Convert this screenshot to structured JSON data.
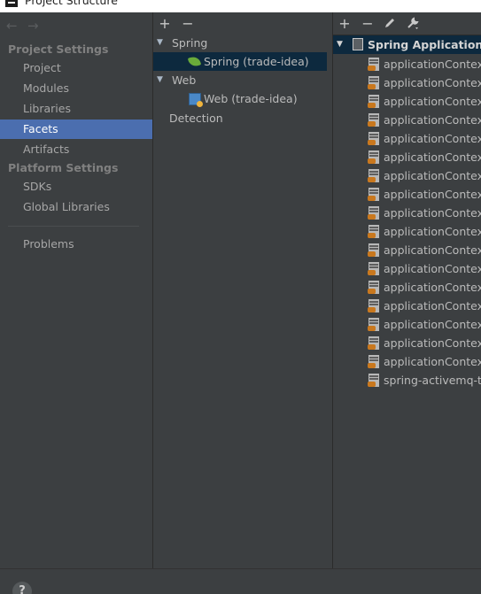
{
  "window": {
    "title": "Project Structure"
  },
  "nav": {
    "back_icon": "←",
    "forward_icon": "→",
    "project_settings_heading": "Project Settings",
    "project_settings_items": [
      "Project",
      "Modules",
      "Libraries",
      "Facets",
      "Artifacts"
    ],
    "platform_settings_heading": "Platform Settings",
    "platform_settings_items": [
      "SDKs",
      "Global Libraries"
    ],
    "problems_label": "Problems",
    "selected_item": "Facets"
  },
  "facets_tree": {
    "add_label": "+",
    "remove_label": "−",
    "groups": [
      {
        "label": "Spring",
        "children": [
          "Spring (trade-idea)"
        ]
      },
      {
        "label": "Web",
        "children": [
          "Web (trade-idea)"
        ]
      }
    ],
    "detection_label": "Detection",
    "selected_item": "Spring (trade-idea)"
  },
  "context_panel": {
    "add_label": "+",
    "remove_label": "−",
    "group_label": "Spring Application Context",
    "files": [
      "applicationContext_",
      "applicationContext_",
      "applicationContext_",
      "applicationContext_",
      "applicationContext_",
      "applicationContext_",
      "applicationContext_",
      "applicationContext_",
      "applicationContext_",
      "applicationContext_",
      "applicationContext_",
      "applicationContext_",
      "applicationContext_",
      "applicationContext_",
      "applicationContext_",
      "applicationContext_",
      "applicationContext_",
      "spring-activemq-to"
    ]
  },
  "footer": {
    "help_label": "?"
  },
  "colors": {
    "background": "#3c3f41",
    "nav_selected": "#4b6eaf",
    "tree_selected": "#0d293e",
    "spring_green": "#6aab3a"
  }
}
